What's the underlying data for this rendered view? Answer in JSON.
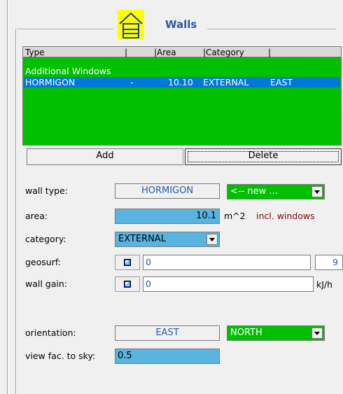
{
  "group": {
    "title": "Walls",
    "logo_icon": "house-garage-icon"
  },
  "list": {
    "headers": {
      "type": "Type",
      "sep1": "|",
      "area": "|Area",
      "category": "|Category",
      "sep2": "|"
    },
    "rows": [
      {
        "type": "Additional Windows",
        "dash": "",
        "area": "",
        "category": "",
        "orientation": "",
        "selected": false
      },
      {
        "type": "HORMIGON",
        "dash": "-",
        "area": "10.10",
        "category": "EXTERNAL",
        "orientation": "EAST",
        "selected": true
      }
    ]
  },
  "buttons": {
    "add": "Add",
    "delete": "Delete"
  },
  "form": {
    "wall_type_label": "wall type:",
    "wall_type_value": "HORMIGON",
    "wall_type_combo": "<-- new ...",
    "area_label": "area:",
    "area_value": "10.1",
    "area_unit": "m^2",
    "area_note": "incl. windows",
    "category_label": "category:",
    "category_value": "EXTERNAL",
    "geosurf_label": "geosurf:",
    "geosurf_value": "0",
    "geosurf_count": "9",
    "wall_gain_label": "wall gain:",
    "wall_gain_value": "0",
    "wall_gain_unit": "kJ/h",
    "orientation_label": "orientation:",
    "orientation_value": "EAST",
    "orientation_combo": "NORTH",
    "view_fac_label": "view fac. to sky:",
    "view_fac_value": "0.5"
  },
  "colors": {
    "accent_green": "#00c000",
    "selection_blue": "#0078d7",
    "field_blue": "#5ab4e0",
    "logo_yellow": "#ffff00",
    "note_red": "#8b0000"
  }
}
